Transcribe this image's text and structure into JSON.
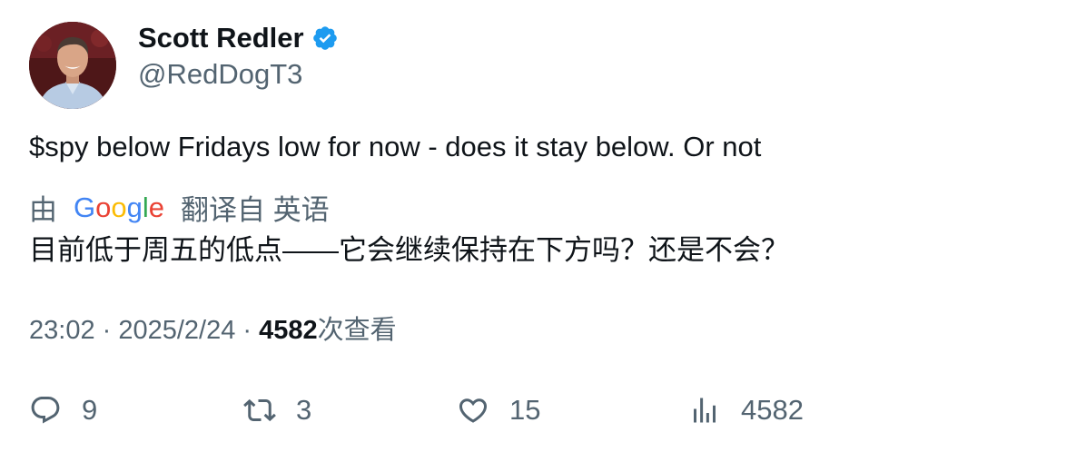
{
  "author": {
    "display_name": "Scott Redler",
    "handle": "@RedDogT3",
    "avatar": "profile-photo",
    "verified_icon": "verified-badge-icon"
  },
  "tweet": {
    "text": "$spy below Fridays low for now - does it stay below. Or not"
  },
  "translation": {
    "prefix": "由",
    "provider_logo": "google-logo",
    "suffix": "翻译自 英语",
    "text": "目前低于周五的低点——它会继续保持在下方吗？还是不会？"
  },
  "meta": {
    "time": "23:02",
    "separator1": " · ",
    "date": "2025/2/24",
    "separator2": " · ",
    "views": "4582",
    "views_suffix": "次查看"
  },
  "actions": {
    "reply_count": "9",
    "retweet_count": "3",
    "like_count": "15",
    "view_count": "4582"
  },
  "colors": {
    "text_primary": "#0f1419",
    "text_secondary": "#536471",
    "verified_blue": "#1d9bf0"
  }
}
